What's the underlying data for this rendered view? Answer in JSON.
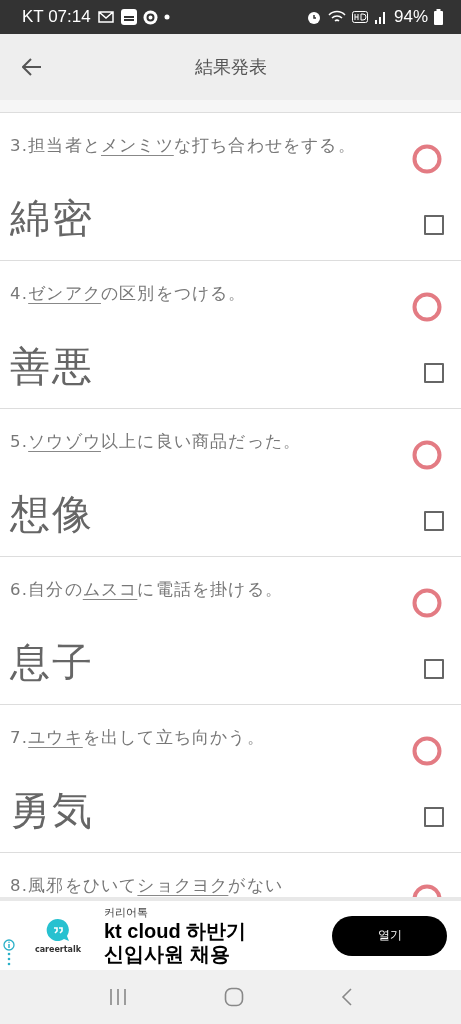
{
  "status_bar": {
    "carrier_time": "KT 07:14",
    "battery": "94%"
  },
  "app_bar": {
    "title": "結果発表"
  },
  "questions": [
    {
      "number": "3.",
      "before": "担当者と",
      "underlined": "メンミツ",
      "after": "な打ち合わせをする。",
      "answer": "綿密",
      "correct": true,
      "checked": false
    },
    {
      "number": "4.",
      "underlined": "ゼンアク",
      "after": "の区別をつける。",
      "answer": "善悪",
      "correct": true,
      "checked": false
    },
    {
      "number": "5.",
      "underlined": "ソウゾウ",
      "after": "以上に良い商品だった。",
      "answer": "想像",
      "correct": true,
      "checked": false
    },
    {
      "number": "6.",
      "before": "自分の",
      "underlined": "ムスコ",
      "after": "に電話を掛ける。",
      "answer": "息子",
      "correct": true,
      "checked": false
    },
    {
      "number": "7.",
      "underlined": "ユウキ",
      "after": "を出して立ち向かう。",
      "answer": "勇気",
      "correct": true,
      "checked": false
    },
    {
      "number": "8.",
      "before": "風邪をひいて",
      "underlined": "ショクヨク",
      "after": "がない",
      "correct": true
    }
  ],
  "ad": {
    "advertiser": "커리어톡",
    "brand": "careertalk",
    "headline": "kt cloud 하반기\n신입사원 채용",
    "button": "열기"
  }
}
